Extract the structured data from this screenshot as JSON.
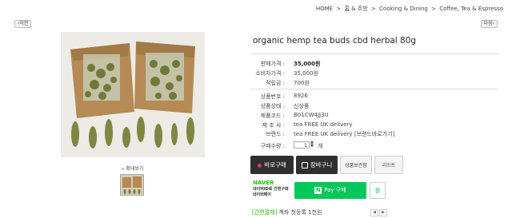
{
  "breadcrumb": {
    "items": [
      "HOME",
      "홈 & 주방",
      "Cooking & Dining",
      "Coffee, Tea & Espresso"
    ],
    "separator": ">"
  },
  "nav": {
    "prev_label": "이전",
    "next_label": "다음"
  },
  "gallery": {
    "zoom_label": "확대보기"
  },
  "product": {
    "title": "organic hemp tea buds cbd herbal 80g",
    "sale_price_label": "판매가격 :",
    "sale_price": "35,000원",
    "consumer_price_label": "소비자가격 :",
    "consumer_price": "35,000원",
    "points_label": "적립금 :",
    "points": "700원",
    "product_no_label": "상품번호 :",
    "product_no": "8926",
    "condition_label": "상품상태 :",
    "condition": "신상품",
    "code_label": "제품코드 :",
    "code": "B01CW4JJ3U",
    "maker_label": "제 조 사 :",
    "maker": "tea FREE UK delivery",
    "brand_label": "브랜드 :",
    "brand": "tea FREE UK delivery",
    "brand_link": "[브랜드바로가기]",
    "qty_label": "구매수량 :",
    "qty_value": "1",
    "qty_unit": "개"
  },
  "actions": {
    "buy_now": "바로구매",
    "cart": "장바구니",
    "wishlist": "상품보관함",
    "list": "리스트"
  },
  "naver": {
    "logo": "NAVER",
    "line1": "네이버ID로 간편구매",
    "line2": "네이버페이",
    "pay_label": "Pay 구매",
    "pay_mark": "N",
    "wish_label": "찜"
  },
  "simple_pay": {
    "tag": "[간편결제]",
    "text": "계좌 첫등록 1천원"
  },
  "colors": {
    "naver_green": "#03c75a",
    "buy_dot": "#e23a5a",
    "dark_button": "#2f2f2f"
  }
}
